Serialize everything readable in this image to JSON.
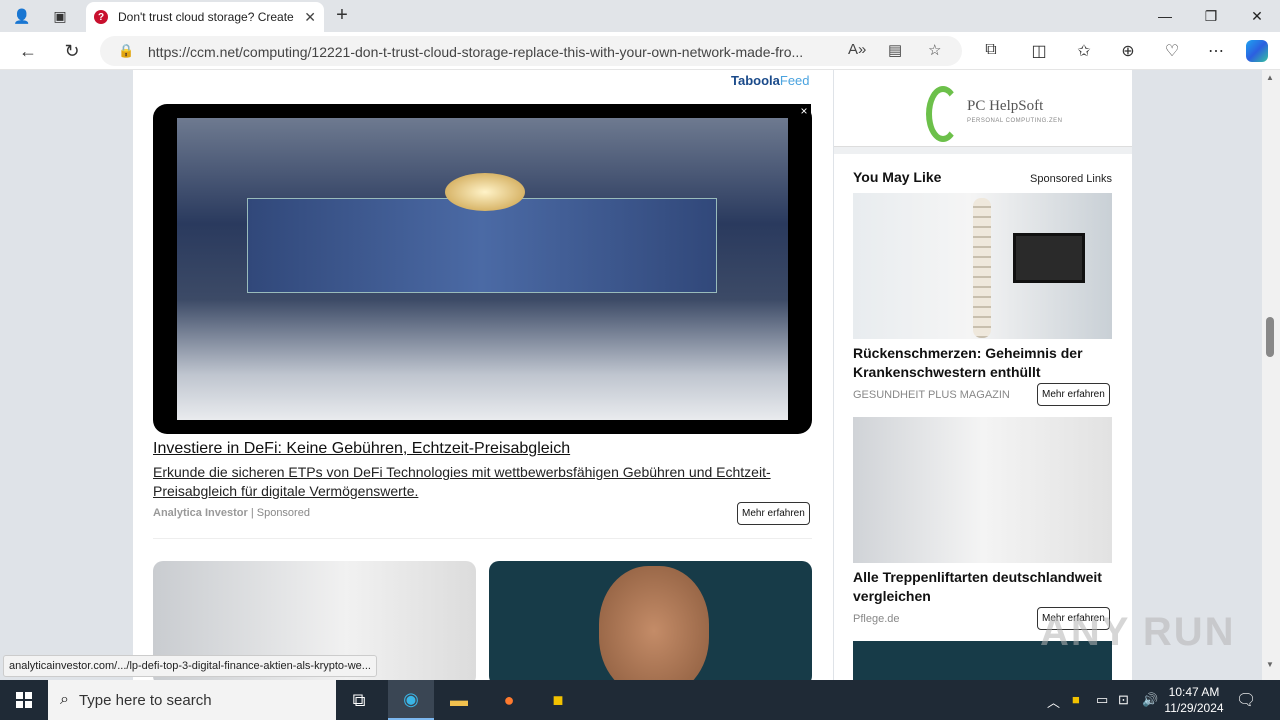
{
  "browser": {
    "tab_title": "Don't trust cloud storage? Create",
    "tab_favicon": "?",
    "url": "https://ccm.net/computing/12221-don-t-trust-cloud-storage-replace-this-with-your-own-network-made-fro...",
    "status_url": "analyticainvestor.com/.../lp-defi-top-3-digital-finance-aktien-als-krypto-we..."
  },
  "feed": {
    "brand": "Taboola",
    "brand_suffix": "Feed",
    "ad": {
      "headline": "Investiere in DeFi: Keine Gebühren, Echtzeit-Preisabgleich",
      "description": "Erkunde die sicheren ETPs von DeFi Technologies mit wettbewerbsfähigen Gebühren und Echtzeit-Preisabgleich für digitale Vermögenswerte.",
      "source": "Analytica Investor",
      "sponsored": "| Sponsored",
      "cta": "Mehr erfahren",
      "close": "×"
    }
  },
  "sidebar": {
    "logo_name": "PC HelpSoft",
    "logo_tagline": "PERSONAL COMPUTING.ZEN",
    "section_title": "You May Like",
    "sponsored_links": "Sponsored Links",
    "items": [
      {
        "title": "Rückenschmerzen: Geheimnis der Krankenschwestern enthüllt",
        "source": "GESUNDHEIT PLUS MAGAZIN",
        "cta": "Mehr erfahren"
      },
      {
        "title": "Alle Treppenliftarten deutschlandweit vergleichen",
        "source": "Pflege.de",
        "cta": "Mehr erfahren"
      }
    ]
  },
  "watermark": "ANY RUN",
  "taskbar": {
    "search_placeholder": "Type here to search",
    "time": "10:47 AM",
    "date": "11/29/2024"
  },
  "colors": {
    "taboola_blue": "#1a4a8a",
    "taskbar": "#1f2a36",
    "favicon_red": "#c8102e"
  }
}
